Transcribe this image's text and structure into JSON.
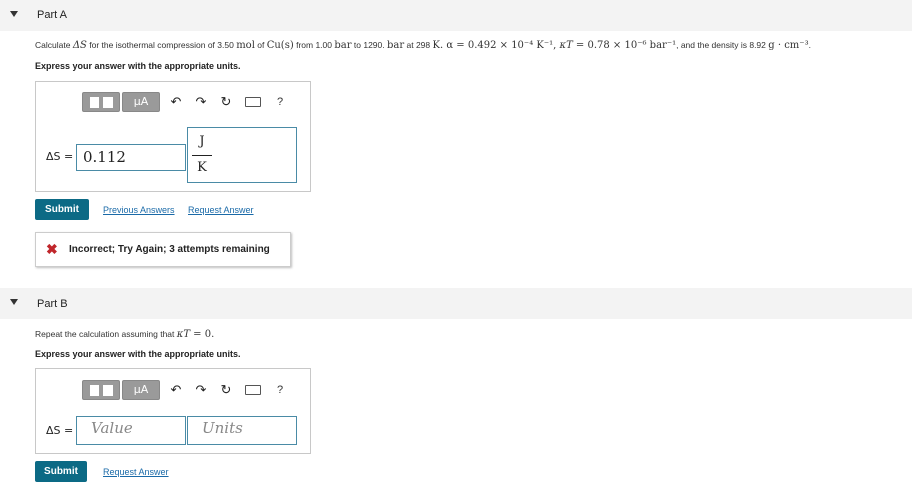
{
  "part_a": {
    "title": "Part A",
    "question": {
      "t1": "Calculate ",
      "ds": "ΔS",
      "t2": " for the isothermal compression of 3.50 ",
      "mol": "mol",
      "t3": " of ",
      "cu": "Cu(s)",
      "t4": " from 1.00 ",
      "bar1": "bar",
      "t5": " to 1290. ",
      "bar2": "bar",
      "t6": " at 298 ",
      "K": "K",
      "t7": ". ",
      "alpha": "α = 0.492 × 10⁻⁴ K⁻¹, ",
      "kappa": "κT",
      "t8": " = 0.78 × 10⁻⁶ bar⁻¹",
      "t9": ", and the density is 8.92 ",
      "dens": "g · cm⁻³",
      "t10": "."
    },
    "instruction": "Express your answer with the appropriate units.",
    "toolbar": {
      "templates": "",
      "mu": "μA",
      "undo": "↶",
      "redo": "↷",
      "reset": "↻",
      "keyboard": "keyboard-icon",
      "help": "?"
    },
    "answer_label": "ΔS =",
    "value": "0.112",
    "units_num": "J",
    "units_den": "K",
    "submit": "Submit",
    "link_previous": "Previous Answers",
    "link_request": "Request Answer",
    "feedback_icon": "✖",
    "feedback": "Incorrect; Try Again; 3 attempts remaining"
  },
  "part_b": {
    "title": "Part B",
    "question": {
      "t1": "Repeat the calculation assuming that ",
      "kappa": "κT",
      "t2": " = 0."
    },
    "instruction": "Express your answer with the appropriate units.",
    "toolbar": {
      "templates": "",
      "mu": "μA",
      "undo": "↶",
      "redo": "↷",
      "reset": "↻",
      "keyboard": "keyboard-icon",
      "help": "?"
    },
    "answer_label": "ΔS =",
    "value_placeholder": "Value",
    "units_placeholder": "Units",
    "submit": "Submit",
    "link_request": "Request Answer"
  },
  "colors": {
    "submit": "#0c6a85",
    "link": "#1a6aa8",
    "field_border": "#4a8ba6",
    "error": "#c0262b",
    "header_bg": "#f3f3f3"
  }
}
